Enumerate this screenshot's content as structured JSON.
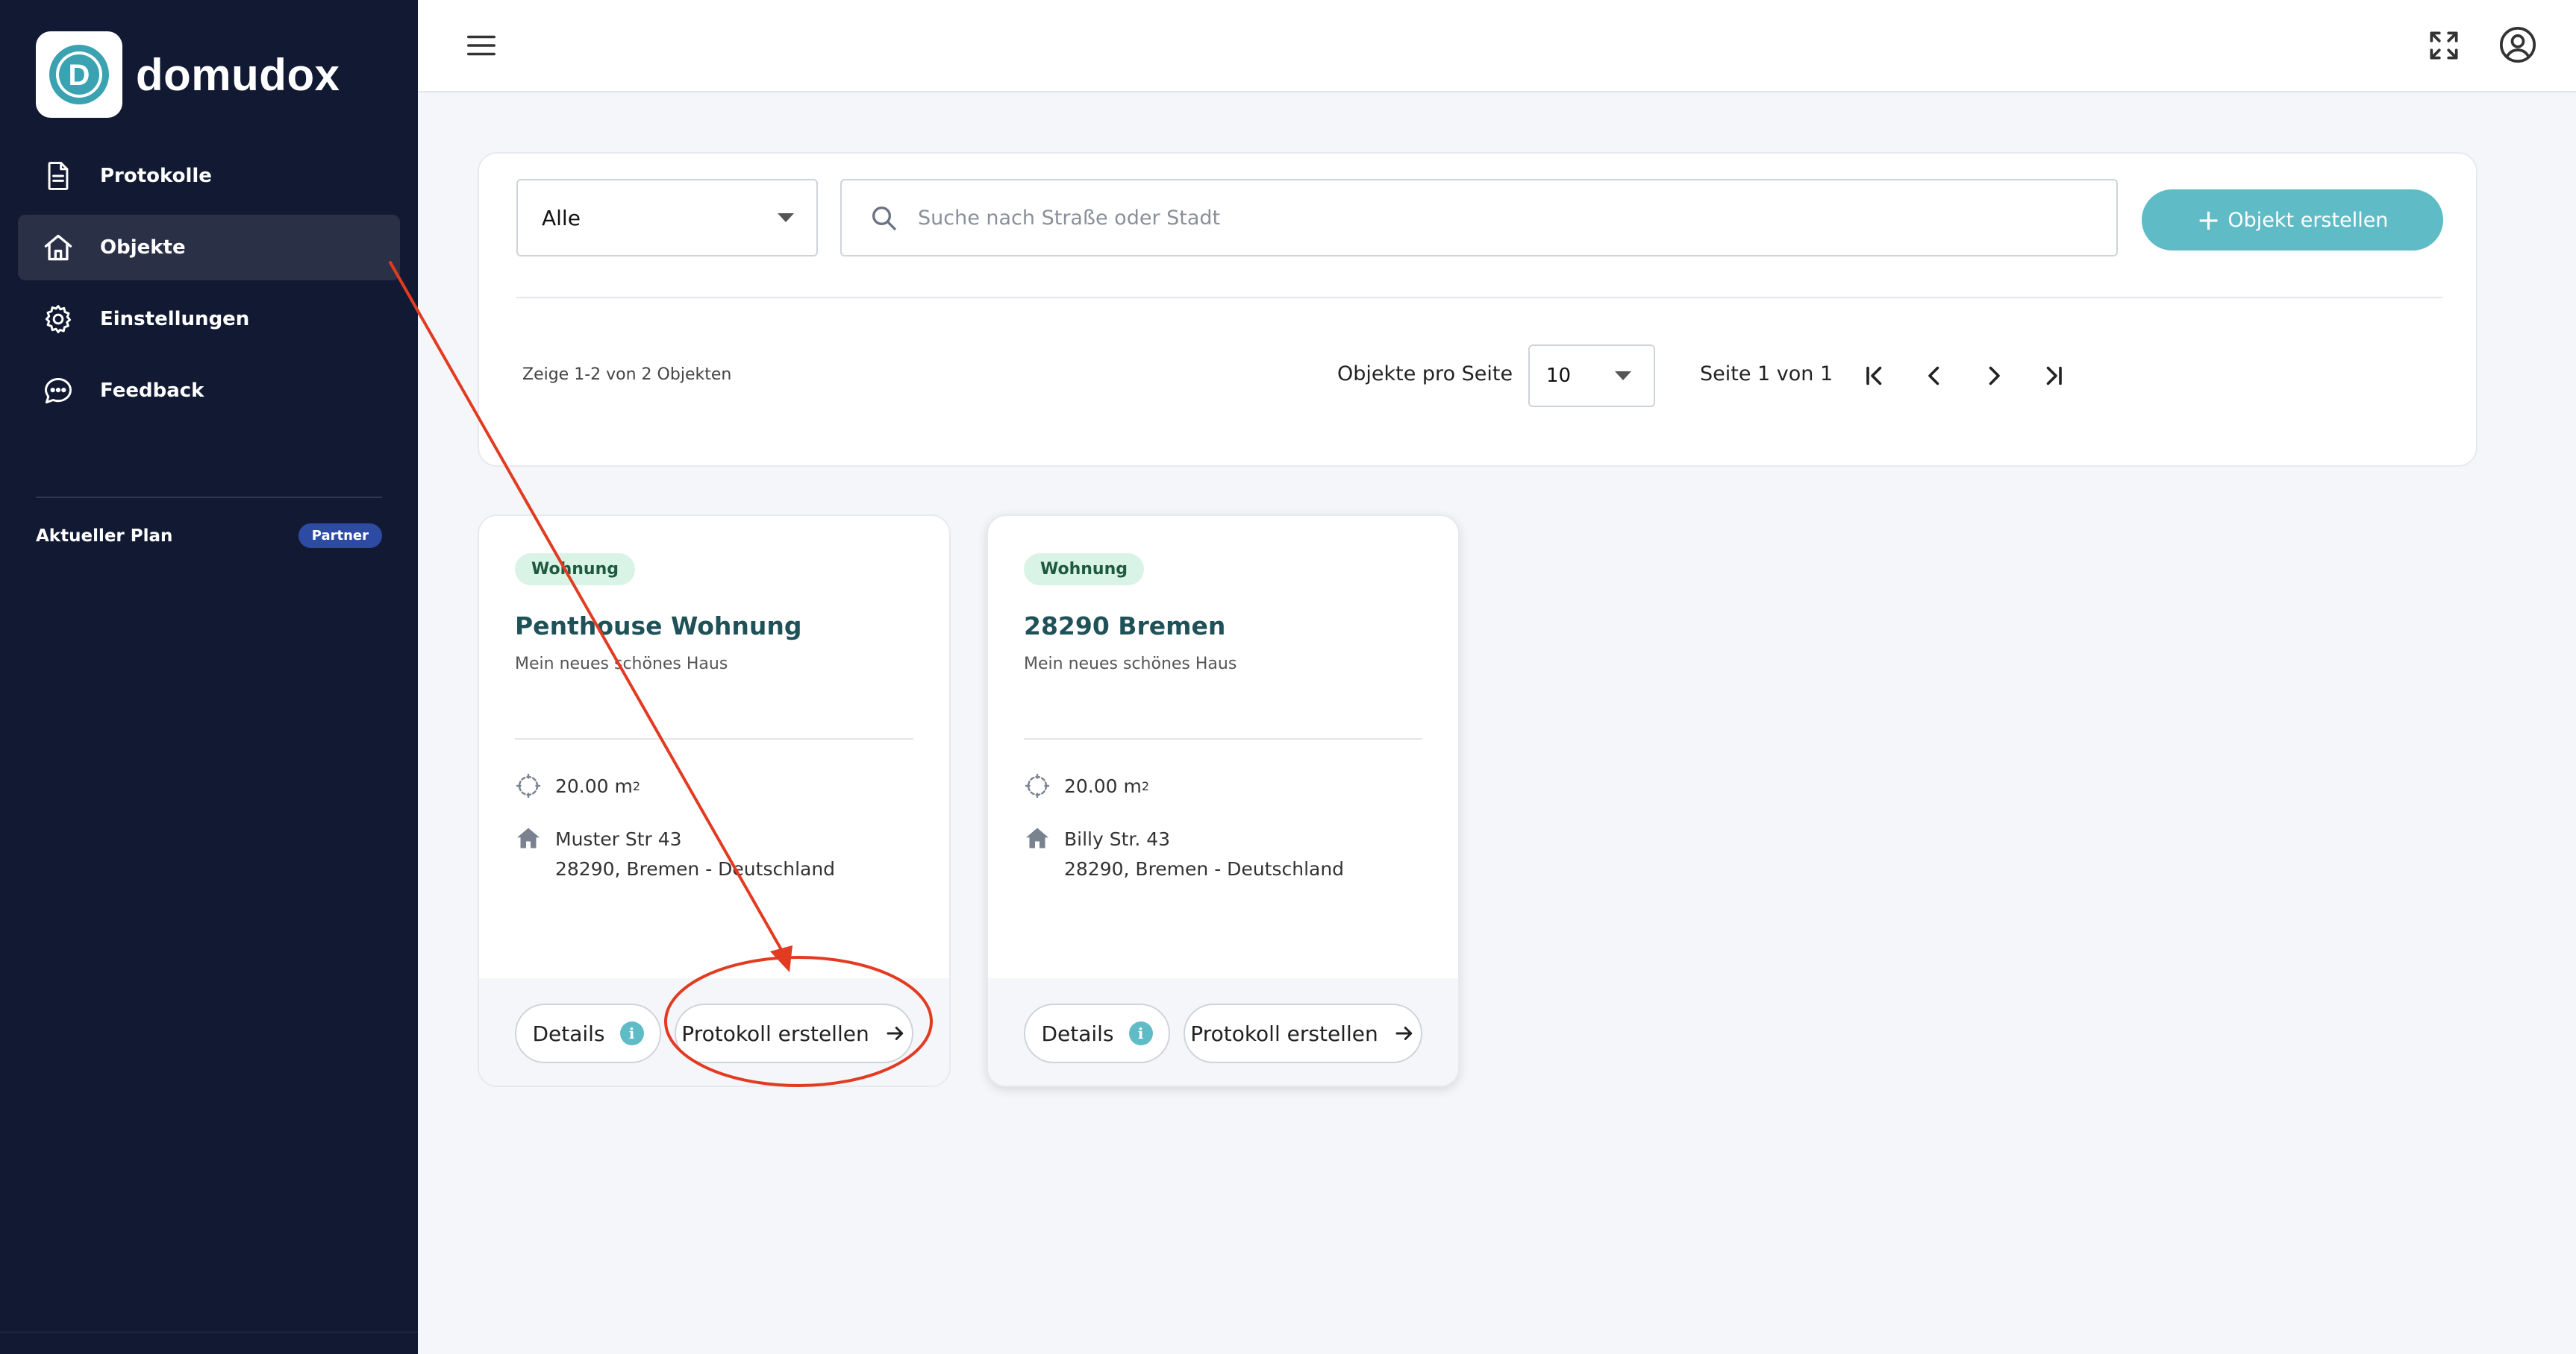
{
  "app": {
    "name": "domudox",
    "logo_letter": "D"
  },
  "sidebar": {
    "items": [
      {
        "label": "Protokolle",
        "icon": "document-icon",
        "active": false
      },
      {
        "label": "Objekte",
        "icon": "home-icon",
        "active": true
      },
      {
        "label": "Einstellungen",
        "icon": "gear-icon",
        "active": false
      },
      {
        "label": "Feedback",
        "icon": "chat-bubble-icon",
        "active": false
      }
    ],
    "plan_label": "Aktueller Plan",
    "plan_badge": "Partner"
  },
  "topbar": {
    "icons": [
      "menu-icon",
      "fullscreen-icon",
      "account-icon"
    ]
  },
  "filters": {
    "type_select_value": "Alle",
    "search_placeholder": "Suche nach Straße oder Stadt",
    "search_value": "",
    "create_button_label": "Objekt erstellen",
    "result_count": "Zeige 1-2 von 2 Objekten",
    "per_page_label": "Objekte pro Seite",
    "per_page_value": "10",
    "page_info": "Seite 1 von 1"
  },
  "objects": [
    {
      "type": "Wohnung",
      "title": "Penthouse Wohnung",
      "description": "Mein neues schönes Haus",
      "area": "20.00 m",
      "area_unit_exp": "2",
      "street": "Muster Str 43",
      "city_line": "28290, Bremen - Deutschland",
      "details_label": "Details",
      "protokoll_label": "Protokoll erstellen"
    },
    {
      "type": "Wohnung",
      "title": "28290 Bremen",
      "description": "Mein neues schönes Haus",
      "area": "20.00 m",
      "area_unit_exp": "2",
      "street": "Billy Str. 43",
      "city_line": "28290, Bremen - Deutschland",
      "details_label": "Details",
      "protokoll_label": "Protokoll erstellen"
    }
  ],
  "colors": {
    "sidebar_bg": "#121a33",
    "accent": "#5fbcc6",
    "annotation": "#e23b22",
    "badge_bg": "#d9f3e6",
    "title_color": "#1f5258",
    "plan_badge_bg": "#2e4ba3"
  }
}
